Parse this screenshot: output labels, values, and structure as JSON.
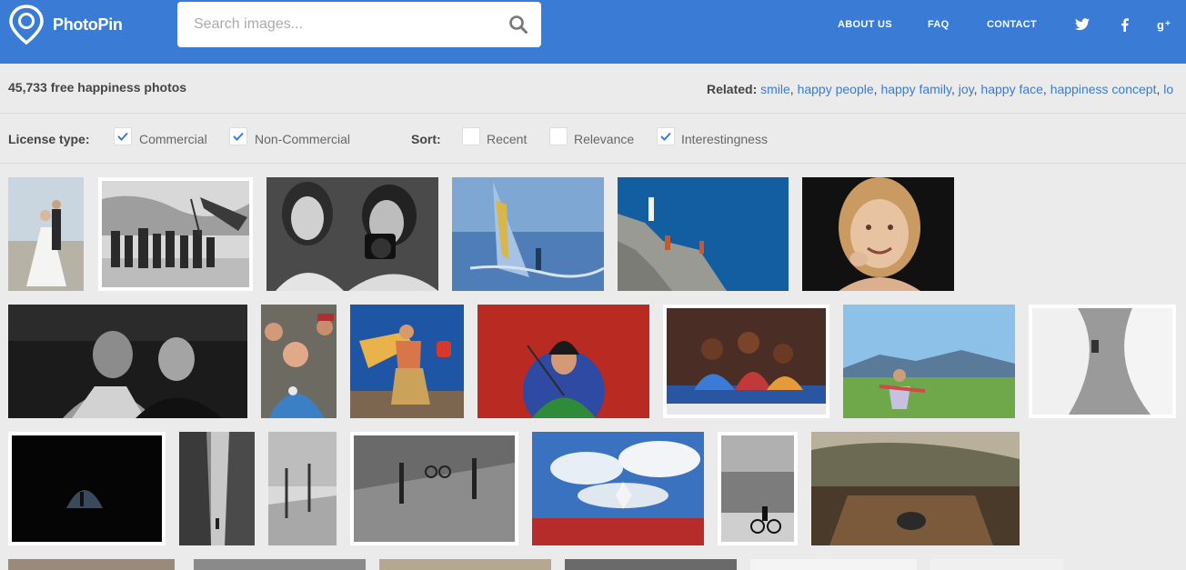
{
  "header": {
    "logo_text": "PhotoPin",
    "search_placeholder": "Search images...",
    "nav": [
      "ABOUT US",
      "FAQ",
      "CONTACT"
    ],
    "social_icons": [
      "twitter-icon",
      "facebook-icon",
      "google-plus-icon"
    ]
  },
  "results": {
    "count_text": "45,733 free happiness photos",
    "related_label": "Related:",
    "related": [
      "smile",
      "happy people",
      "happy family",
      "joy",
      "happy face",
      "happiness concept",
      "lo"
    ]
  },
  "filters": {
    "license_label": "License type:",
    "license_options": [
      {
        "label": "Commercial",
        "checked": true
      },
      {
        "label": "Non-Commercial",
        "checked": true
      }
    ],
    "sort_label": "Sort:",
    "sort_options": [
      {
        "label": "Recent",
        "checked": false
      },
      {
        "label": "Relevance",
        "checked": false
      },
      {
        "label": "Interestingness",
        "checked": true
      }
    ]
  },
  "colors": {
    "header_bg": "#3a7bd5",
    "page_bg": "#ebebeb",
    "link": "#3a7bd5",
    "check": "#3a7bd5"
  },
  "photos": [
    {
      "subject": "wedding-couple"
    },
    {
      "subject": "group-with-flag-bw"
    },
    {
      "subject": "women-with-camera-bw"
    },
    {
      "subject": "windsurfer"
    },
    {
      "subject": "fishermen-on-rocks"
    },
    {
      "subject": "smiling-child"
    },
    {
      "subject": "men-at-night"
    },
    {
      "subject": "men-in-crowd"
    },
    {
      "subject": "carnival-dancer"
    },
    {
      "subject": "woman-red-background"
    },
    {
      "subject": "children-on-truck"
    },
    {
      "subject": "child-in-field"
    },
    {
      "subject": "aerial-curves-bw"
    },
    {
      "subject": "dark-tunnel"
    },
    {
      "subject": "narrow-alley"
    },
    {
      "subject": "tree-lined-path-bw"
    },
    {
      "subject": "cyclist-street-bw"
    },
    {
      "subject": "girl-jumping-in-sky"
    },
    {
      "subject": "cyclist-building-bw"
    },
    {
      "subject": "couple-on-deck"
    }
  ]
}
